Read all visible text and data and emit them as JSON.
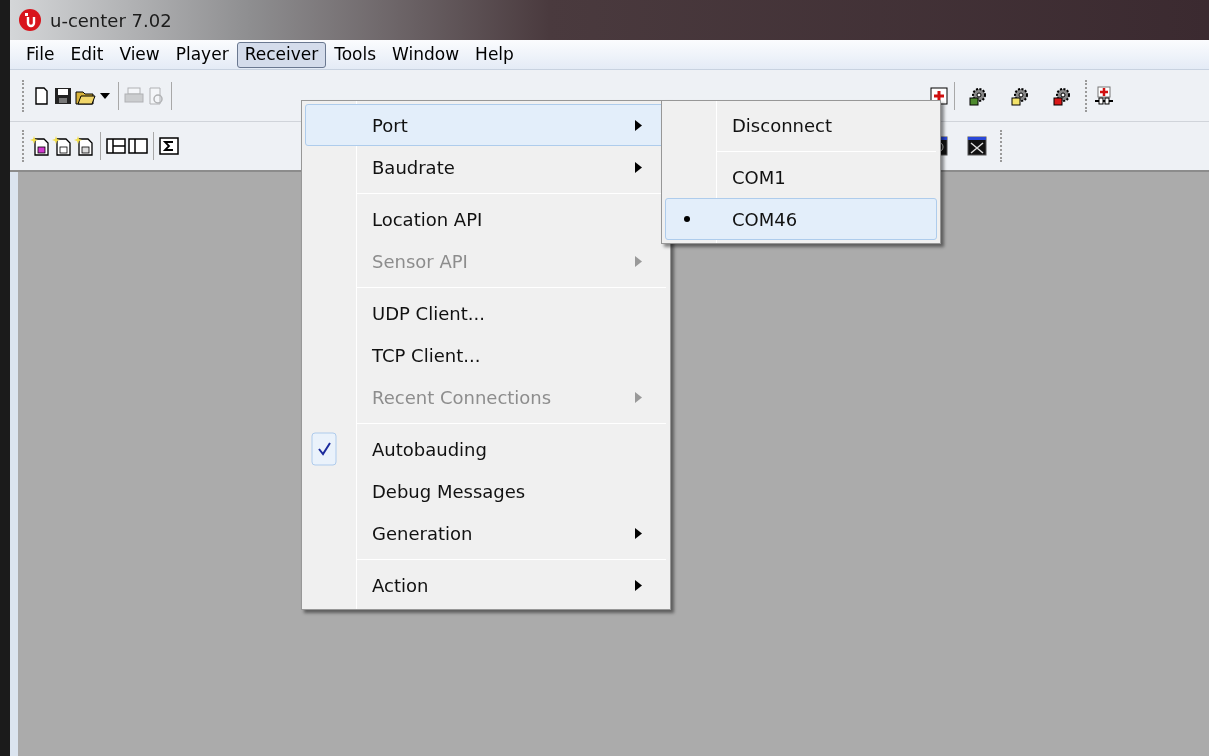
{
  "window": {
    "title": "u-center 7.02"
  },
  "menu_bar": [
    {
      "label": "File",
      "selected": false
    },
    {
      "label": "Edit",
      "selected": false
    },
    {
      "label": "View",
      "selected": false
    },
    {
      "label": "Player",
      "selected": false
    },
    {
      "label": "Receiver",
      "selected": true
    },
    {
      "label": "Tools",
      "selected": false
    },
    {
      "label": "Window",
      "selected": false
    },
    {
      "label": "Help",
      "selected": false
    }
  ],
  "receiver_menu": [
    {
      "kind": "item",
      "label": "Port",
      "submenu": true,
      "disabled": false,
      "checked": false,
      "selected": true
    },
    {
      "kind": "item",
      "label": "Baudrate",
      "submenu": true,
      "disabled": false,
      "checked": false,
      "selected": false
    },
    {
      "kind": "separator"
    },
    {
      "kind": "item",
      "label": "Location API",
      "submenu": false,
      "disabled": false,
      "checked": false,
      "selected": false
    },
    {
      "kind": "item",
      "label": "Sensor API",
      "submenu": true,
      "disabled": true,
      "checked": false,
      "selected": false
    },
    {
      "kind": "separator"
    },
    {
      "kind": "item",
      "label": "UDP Client...",
      "submenu": false,
      "disabled": false,
      "checked": false,
      "selected": false
    },
    {
      "kind": "item",
      "label": "TCP Client...",
      "submenu": false,
      "disabled": false,
      "checked": false,
      "selected": false
    },
    {
      "kind": "item",
      "label": "Recent Connections",
      "submenu": true,
      "disabled": true,
      "checked": false,
      "selected": false
    },
    {
      "kind": "separator"
    },
    {
      "kind": "item",
      "label": "Autobauding",
      "submenu": false,
      "disabled": false,
      "checked": true,
      "selected": false
    },
    {
      "kind": "item",
      "label": "Debug Messages",
      "submenu": false,
      "disabled": false,
      "checked": false,
      "selected": false
    },
    {
      "kind": "item",
      "label": "Generation",
      "submenu": true,
      "disabled": false,
      "checked": false,
      "selected": false
    },
    {
      "kind": "separator"
    },
    {
      "kind": "item",
      "label": "Action",
      "submenu": true,
      "disabled": false,
      "checked": false,
      "selected": false
    }
  ],
  "port_submenu": [
    {
      "kind": "item",
      "label": "Disconnect",
      "checked": false,
      "selected": false
    },
    {
      "kind": "separator"
    },
    {
      "kind": "item",
      "label": "COM1",
      "checked": false,
      "selected": false
    },
    {
      "kind": "item",
      "label": "COM46",
      "checked": true,
      "selected": true
    }
  ]
}
